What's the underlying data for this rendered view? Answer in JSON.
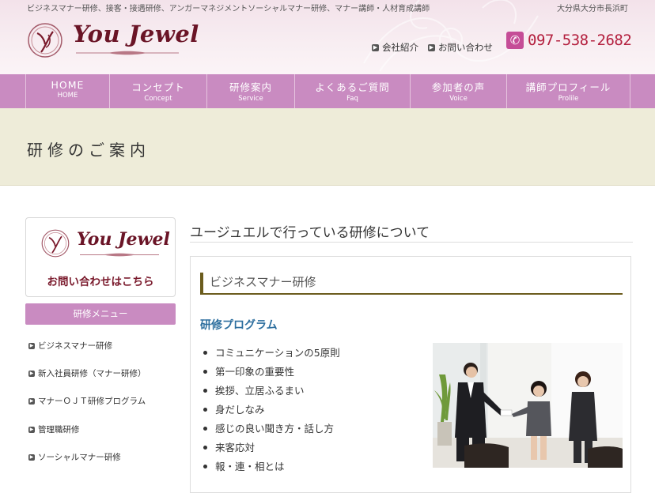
{
  "header": {
    "tagline": "ビジネスマナー研修、接客・接遇研修、アンガーマネジメントソーシャルマナー研修、マナー講師・人材育成講師",
    "address": "大分県大分市長浜町",
    "logo_text": "You Jewel",
    "links": [
      "会社紹介",
      "お問い合わせ"
    ],
    "phone": "097-538-2682"
  },
  "nav": [
    {
      "jp": "HOME",
      "en": "HOME"
    },
    {
      "jp": "コンセプト",
      "en": "Concept"
    },
    {
      "jp": "研修案内",
      "en": "Service"
    },
    {
      "jp": "よくあるご質問",
      "en": "Faq"
    },
    {
      "jp": "参加者の声",
      "en": "Voice"
    },
    {
      "jp": "講師プロフィール",
      "en": "Prolile"
    }
  ],
  "page_title": "研修のご案内",
  "sidebar": {
    "logo_text": "You Jewel",
    "contact_label": "お問い合わせはこちら",
    "menu_heading": "研修メニュー",
    "items": [
      "ビジネスマナー研修",
      "新入社員研修（マナー研修）",
      "マナーＯＪＴ研修プログラム",
      "管理職研修",
      "ソーシャルマナー研修"
    ]
  },
  "main": {
    "heading": "ユージュエルで行っている研修について",
    "section_title": "ビジネスマナー研修",
    "program_title": "研修プログラム",
    "bullets": [
      "コミュニケーションの5原則",
      "第一印象の重要性",
      "挨拶、立居ふるまい",
      "身だしなみ",
      "感じの良い聞き方・話し方",
      "来客応対",
      "報・連・相とは"
    ]
  },
  "colors": {
    "nav_bg": "#c98bc1",
    "logo": "#6a1426",
    "phone": "#b4203f",
    "accent_blue": "#2c6e9e",
    "title_band": "#eeecd9"
  }
}
